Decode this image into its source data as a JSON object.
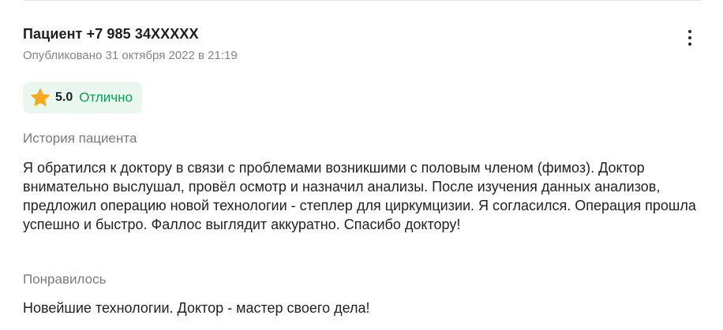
{
  "review": {
    "author": "Пациент +7 985 34XXXXX",
    "published": "Опубликовано 31 октября 2022 в 21:19",
    "menu_icon": "more-vertical-icon",
    "rating": {
      "icon": "star-icon",
      "value": "5.0",
      "label": "Отлично",
      "star_color": "#f7a823",
      "label_color": "#119a52",
      "badge_bg": "#e9f7ef"
    },
    "history": {
      "label": "История пациента",
      "text": "Я обратился к доктору в связи с проблемами возникшими с половым членом (фимоз). Доктор внимательно выслушал, провёл осмотр и назначил анализы. После изучения данных анализов, предложил операцию новой технологии - степлер для циркумцизии. Я согласился. Операция прошла успешно и быстро. Фаллос выглядит аккуратно. Спасибо доктору!"
    },
    "liked": {
      "label": "Понравилось",
      "text": "Новейшие технологии. Доктор - мастер своего дела!"
    }
  }
}
